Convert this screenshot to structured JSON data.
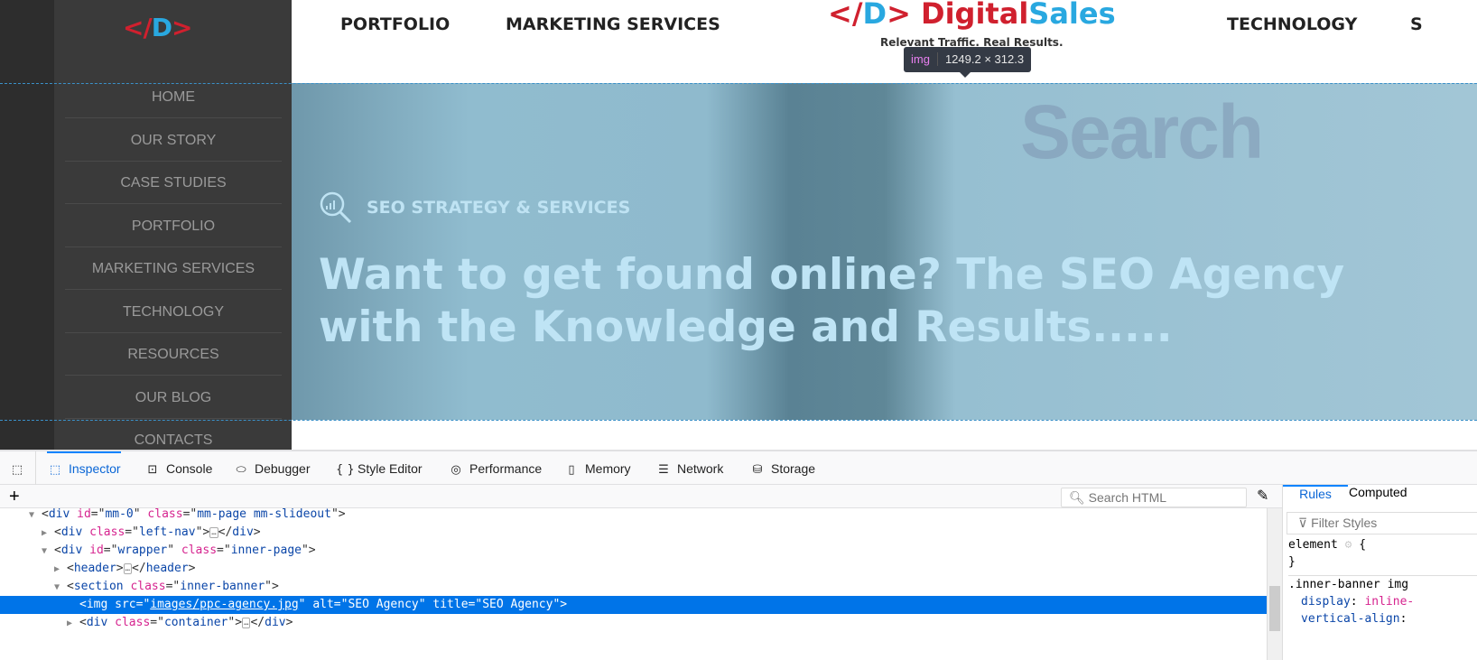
{
  "site": {
    "sidebar_logo": "</D>",
    "sidebar": [
      "HOME",
      "OUR STORY",
      "CASE STUDIES",
      "PORTFOLIO",
      "MARKETING SERVICES",
      "TECHNOLOGY",
      "RESOURCES",
      "OUR BLOG",
      "CONTACTS"
    ],
    "header_nav": [
      "PORTFOLIO",
      "MARKETING SERVICES",
      "TECHNOLOGY",
      "S"
    ],
    "logo": {
      "mark": "</D>",
      "word1": "Digital",
      "word2": "Sales",
      "tagline": "Relevant Traffic. Real Results.",
      "color_red": "#d0202e",
      "color_blue": "#29a8e0"
    },
    "banner": {
      "bg_word": "Search",
      "kicker": "SEO STRATEGY & SERVICES",
      "headline": "Want to get found online? The SEO Agency with the Knowledge and Results.....",
      "icon": "magnifier-chart-icon"
    }
  },
  "tooltip": {
    "tag": "img",
    "size": "1249.2 × 312.3"
  },
  "devtools": {
    "tabs": [
      {
        "label": "Inspector",
        "icon": "inspector-icon"
      },
      {
        "label": "Console",
        "icon": "console-icon"
      },
      {
        "label": "Debugger",
        "icon": "debugger-icon"
      },
      {
        "label": "Style Editor",
        "icon": "braces-icon"
      },
      {
        "label": "Performance",
        "icon": "performance-icon"
      },
      {
        "label": "Memory",
        "icon": "memory-icon"
      },
      {
        "label": "Network",
        "icon": "network-icon"
      },
      {
        "label": "Storage",
        "icon": "storage-icon"
      }
    ],
    "search_placeholder": "Search HTML",
    "tree": [
      {
        "tag": "div",
        "attrs": [
          [
            "id",
            "mm-0"
          ],
          [
            "class",
            "mm-page mm-slideout"
          ]
        ],
        "open": true
      },
      {
        "tag": "div",
        "attrs": [
          [
            "class",
            "left-nav"
          ]
        ],
        "open": false
      },
      {
        "tag": "div",
        "attrs": [
          [
            "id",
            "wrapper"
          ],
          [
            "class",
            "inner-page"
          ]
        ],
        "open": true
      },
      {
        "tag": "header",
        "attrs": [],
        "open": false
      },
      {
        "tag": "section",
        "attrs": [
          [
            "class",
            "inner-banner"
          ]
        ],
        "open": true
      },
      {
        "tag": "img",
        "attrs": [
          [
            "src",
            "images/ppc-agency.jpg"
          ],
          [
            "alt",
            "SEO Agency"
          ],
          [
            "title",
            "SEO Agency"
          ]
        ],
        "selected": true
      },
      {
        "tag": "div",
        "attrs": [
          [
            "class",
            "container"
          ]
        ],
        "open": false
      }
    ],
    "rules_tabs": [
      "Rules",
      "Computed"
    ],
    "filter_placeholder": "Filter Styles",
    "rules": {
      "element": "element",
      "brace_open": "{",
      "brace_close": "}",
      "selector": ".inner-banner img",
      "p1": "display",
      "v1": "inline-",
      "p2": "vertical-align",
      "accent": "#0a84ff"
    }
  }
}
